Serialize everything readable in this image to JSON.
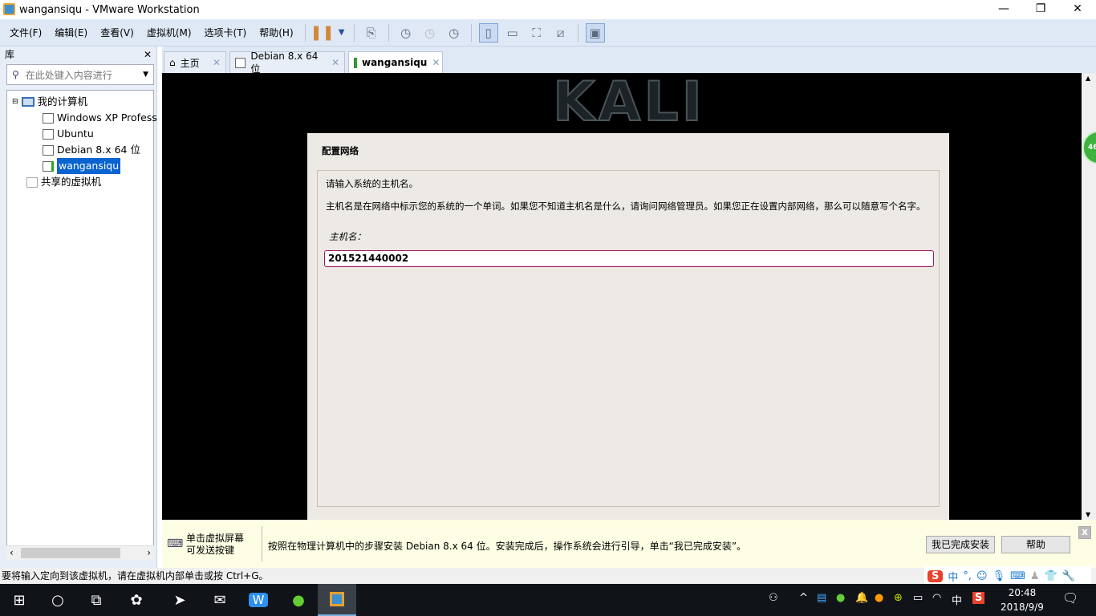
{
  "window": {
    "title": "wangansiqu - VMware Workstation",
    "minimize": "—",
    "maximize": "❐",
    "close": "✕"
  },
  "menu": [
    "文件(F)",
    "编辑(E)",
    "查看(V)",
    "虚拟机(M)",
    "选项卡(T)",
    "帮助(H)"
  ],
  "library": {
    "title": "库",
    "close": "✕",
    "search_placeholder": "在此处键入内容进行",
    "tree": {
      "root": "我的计算机",
      "vms": [
        "Windows XP Profess",
        "Ubuntu",
        "Debian 8.x 64 位",
        "wangansiqu"
      ],
      "shared": "共享的虚拟机"
    }
  },
  "tabs": [
    {
      "label": "主页"
    },
    {
      "label": "Debian 8.x 64 位"
    },
    {
      "label": "wangansiqu",
      "active": true
    }
  ],
  "tab_close": "✕",
  "vm": {
    "banner": "KALI LINUX",
    "section_title": "配置网络",
    "prompt": "请输入系统的主机名。",
    "description": "主机名是在网络中标示您的系统的一个单词。如果您不知道主机名是什么，请询问网络管理员。如果您正在设置内部网络，那么可以随意写个名字。",
    "field_label": "主机名：",
    "hostname": "201521440002",
    "badge": "46"
  },
  "hint": {
    "key_text_1": "单击虚拟屏幕",
    "key_text_2": "可发送按键",
    "message": "按照在物理计算机中的步骤安装 Debian 8.x 64 位。安装完成后，操作系统会进行引导，单击“我已完成安装”。",
    "done_button": "我已完成安装",
    "help_button": "帮助",
    "close": "x"
  },
  "statusbar": "要将输入定向到该虚拟机，请在虚拟机内部单击或按 Ctrl+G。",
  "ime": {
    "lang": "中",
    "punct": "°,"
  },
  "taskbar": {
    "tray_lang": "中",
    "time": "20:48",
    "date": "2018/9/9"
  }
}
